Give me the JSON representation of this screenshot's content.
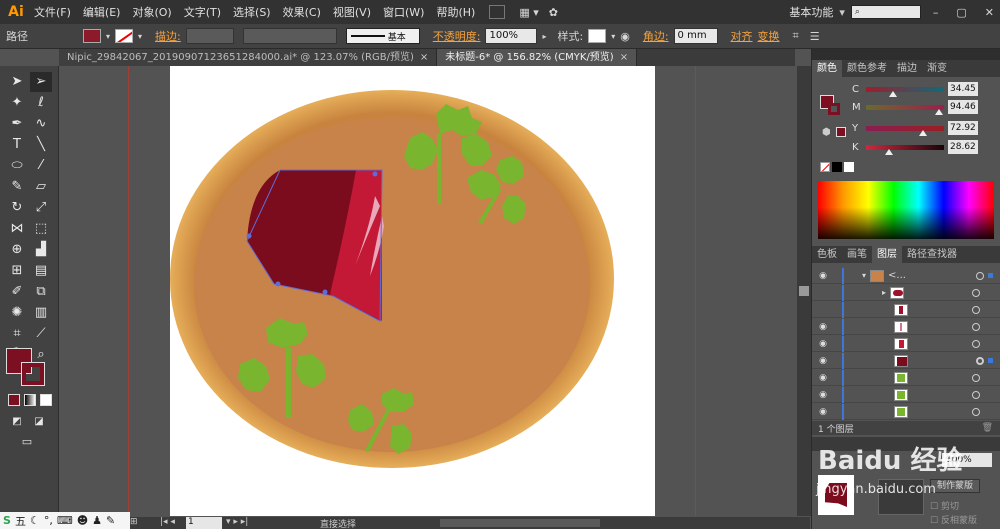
{
  "app": {
    "logo": "Ai"
  },
  "menu": [
    "文件(F)",
    "编辑(E)",
    "对象(O)",
    "文字(T)",
    "选择(S)",
    "效果(C)",
    "视图(V)",
    "窗口(W)",
    "帮助(H)"
  ],
  "workspace": {
    "label": "基本功能",
    "search_icon": "search-icon"
  },
  "control_bar": {
    "selection_type": "路径",
    "fill_color": "#8b1a2b",
    "stroke_label": "描边:",
    "brush_label": "基本",
    "opacity_label": "不透明度:",
    "opacity_value": "100%",
    "style_label": "样式:",
    "corner_label": "角边:",
    "corner_value": "0 mm",
    "align_label": "对齐",
    "transform_label": "变换"
  },
  "tabs": [
    {
      "label": "Nipic_29842067_20190907123651284000.ai* @ 123.07% (RGB/预览)",
      "close": "×"
    },
    {
      "label": "未标题-6* @ 156.82% (CMYK/预览)",
      "close": "×"
    }
  ],
  "color_panel": {
    "tabs": [
      "颜色",
      "颜色参考",
      "描边",
      "渐变"
    ],
    "sliders": [
      {
        "label": "C",
        "value": "34.45",
        "pos": 0.34
      },
      {
        "label": "M",
        "value": "94.46",
        "pos": 0.94
      },
      {
        "label": "Y",
        "value": "72.92",
        "pos": 0.73
      },
      {
        "label": "K",
        "value": "28.62",
        "pos": 0.29
      }
    ]
  },
  "layers_panel": {
    "tabs": [
      "色板",
      "画笔",
      "图层",
      "路径查找器"
    ],
    "top_layer_name": "<...",
    "footer_count": "1 个图层"
  },
  "transparency": {
    "value": "100%",
    "make_mask": "制作蒙版",
    "clip": "剪切",
    "invert": "反相蒙版"
  },
  "status": {
    "zoom": "1",
    "tool": "直接选择"
  },
  "ime": {
    "label": "五"
  },
  "watermark": "Baidu 经验",
  "watermark_url": "jingyan.baidu.com"
}
